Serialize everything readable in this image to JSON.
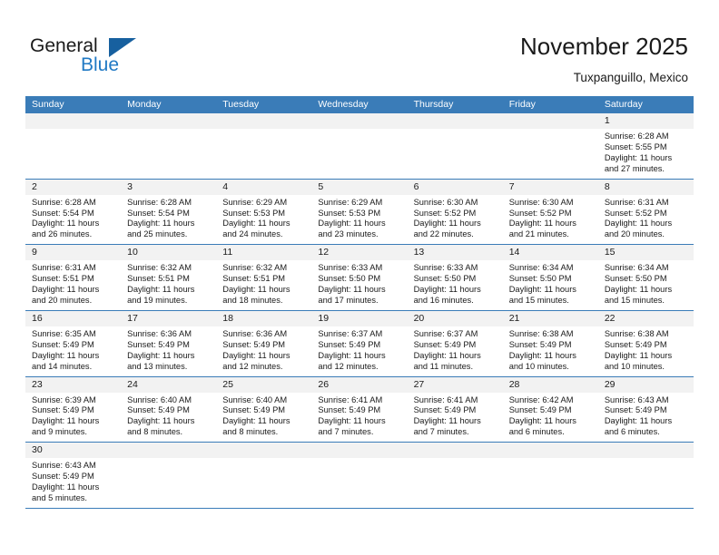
{
  "brand": {
    "name_part1": "General",
    "name_part2": "Blue"
  },
  "header": {
    "title": "November 2025",
    "subtitle": "Tuxpanguillo, Mexico"
  },
  "colors": {
    "header_blue": "#3a7cb8",
    "logo_blue": "#2079c4",
    "datestrip_gray": "#f2f2f2"
  },
  "calendar": {
    "weekday_headers": [
      "Sunday",
      "Monday",
      "Tuesday",
      "Wednesday",
      "Thursday",
      "Friday",
      "Saturday"
    ],
    "weeks": [
      {
        "days": [
          {
            "num": "",
            "lines": [
              "",
              "",
              "",
              ""
            ],
            "empty": true
          },
          {
            "num": "",
            "lines": [
              "",
              "",
              "",
              ""
            ],
            "empty": true
          },
          {
            "num": "",
            "lines": [
              "",
              "",
              "",
              ""
            ],
            "empty": true
          },
          {
            "num": "",
            "lines": [
              "",
              "",
              "",
              ""
            ],
            "empty": true
          },
          {
            "num": "",
            "lines": [
              "",
              "",
              "",
              ""
            ],
            "empty": true
          },
          {
            "num": "",
            "lines": [
              "",
              "",
              "",
              ""
            ],
            "empty": true
          },
          {
            "num": "1",
            "lines": [
              "Sunrise: 6:28 AM",
              "Sunset: 5:55 PM",
              "Daylight: 11 hours",
              "and 27 minutes."
            ],
            "empty": false
          }
        ]
      },
      {
        "days": [
          {
            "num": "2",
            "lines": [
              "Sunrise: 6:28 AM",
              "Sunset: 5:54 PM",
              "Daylight: 11 hours",
              "and 26 minutes."
            ],
            "empty": false
          },
          {
            "num": "3",
            "lines": [
              "Sunrise: 6:28 AM",
              "Sunset: 5:54 PM",
              "Daylight: 11 hours",
              "and 25 minutes."
            ],
            "empty": false
          },
          {
            "num": "4",
            "lines": [
              "Sunrise: 6:29 AM",
              "Sunset: 5:53 PM",
              "Daylight: 11 hours",
              "and 24 minutes."
            ],
            "empty": false
          },
          {
            "num": "5",
            "lines": [
              "Sunrise: 6:29 AM",
              "Sunset: 5:53 PM",
              "Daylight: 11 hours",
              "and 23 minutes."
            ],
            "empty": false
          },
          {
            "num": "6",
            "lines": [
              "Sunrise: 6:30 AM",
              "Sunset: 5:52 PM",
              "Daylight: 11 hours",
              "and 22 minutes."
            ],
            "empty": false
          },
          {
            "num": "7",
            "lines": [
              "Sunrise: 6:30 AM",
              "Sunset: 5:52 PM",
              "Daylight: 11 hours",
              "and 21 minutes."
            ],
            "empty": false
          },
          {
            "num": "8",
            "lines": [
              "Sunrise: 6:31 AM",
              "Sunset: 5:52 PM",
              "Daylight: 11 hours",
              "and 20 minutes."
            ],
            "empty": false
          }
        ]
      },
      {
        "days": [
          {
            "num": "9",
            "lines": [
              "Sunrise: 6:31 AM",
              "Sunset: 5:51 PM",
              "Daylight: 11 hours",
              "and 20 minutes."
            ],
            "empty": false
          },
          {
            "num": "10",
            "lines": [
              "Sunrise: 6:32 AM",
              "Sunset: 5:51 PM",
              "Daylight: 11 hours",
              "and 19 minutes."
            ],
            "empty": false
          },
          {
            "num": "11",
            "lines": [
              "Sunrise: 6:32 AM",
              "Sunset: 5:51 PM",
              "Daylight: 11 hours",
              "and 18 minutes."
            ],
            "empty": false
          },
          {
            "num": "12",
            "lines": [
              "Sunrise: 6:33 AM",
              "Sunset: 5:50 PM",
              "Daylight: 11 hours",
              "and 17 minutes."
            ],
            "empty": false
          },
          {
            "num": "13",
            "lines": [
              "Sunrise: 6:33 AM",
              "Sunset: 5:50 PM",
              "Daylight: 11 hours",
              "and 16 minutes."
            ],
            "empty": false
          },
          {
            "num": "14",
            "lines": [
              "Sunrise: 6:34 AM",
              "Sunset: 5:50 PM",
              "Daylight: 11 hours",
              "and 15 minutes."
            ],
            "empty": false
          },
          {
            "num": "15",
            "lines": [
              "Sunrise: 6:34 AM",
              "Sunset: 5:50 PM",
              "Daylight: 11 hours",
              "and 15 minutes."
            ],
            "empty": false
          }
        ]
      },
      {
        "days": [
          {
            "num": "16",
            "lines": [
              "Sunrise: 6:35 AM",
              "Sunset: 5:49 PM",
              "Daylight: 11 hours",
              "and 14 minutes."
            ],
            "empty": false
          },
          {
            "num": "17",
            "lines": [
              "Sunrise: 6:36 AM",
              "Sunset: 5:49 PM",
              "Daylight: 11 hours",
              "and 13 minutes."
            ],
            "empty": false
          },
          {
            "num": "18",
            "lines": [
              "Sunrise: 6:36 AM",
              "Sunset: 5:49 PM",
              "Daylight: 11 hours",
              "and 12 minutes."
            ],
            "empty": false
          },
          {
            "num": "19",
            "lines": [
              "Sunrise: 6:37 AM",
              "Sunset: 5:49 PM",
              "Daylight: 11 hours",
              "and 12 minutes."
            ],
            "empty": false
          },
          {
            "num": "20",
            "lines": [
              "Sunrise: 6:37 AM",
              "Sunset: 5:49 PM",
              "Daylight: 11 hours",
              "and 11 minutes."
            ],
            "empty": false
          },
          {
            "num": "21",
            "lines": [
              "Sunrise: 6:38 AM",
              "Sunset: 5:49 PM",
              "Daylight: 11 hours",
              "and 10 minutes."
            ],
            "empty": false
          },
          {
            "num": "22",
            "lines": [
              "Sunrise: 6:38 AM",
              "Sunset: 5:49 PM",
              "Daylight: 11 hours",
              "and 10 minutes."
            ],
            "empty": false
          }
        ]
      },
      {
        "days": [
          {
            "num": "23",
            "lines": [
              "Sunrise: 6:39 AM",
              "Sunset: 5:49 PM",
              "Daylight: 11 hours",
              "and 9 minutes."
            ],
            "empty": false
          },
          {
            "num": "24",
            "lines": [
              "Sunrise: 6:40 AM",
              "Sunset: 5:49 PM",
              "Daylight: 11 hours",
              "and 8 minutes."
            ],
            "empty": false
          },
          {
            "num": "25",
            "lines": [
              "Sunrise: 6:40 AM",
              "Sunset: 5:49 PM",
              "Daylight: 11 hours",
              "and 8 minutes."
            ],
            "empty": false
          },
          {
            "num": "26",
            "lines": [
              "Sunrise: 6:41 AM",
              "Sunset: 5:49 PM",
              "Daylight: 11 hours",
              "and 7 minutes."
            ],
            "empty": false
          },
          {
            "num": "27",
            "lines": [
              "Sunrise: 6:41 AM",
              "Sunset: 5:49 PM",
              "Daylight: 11 hours",
              "and 7 minutes."
            ],
            "empty": false
          },
          {
            "num": "28",
            "lines": [
              "Sunrise: 6:42 AM",
              "Sunset: 5:49 PM",
              "Daylight: 11 hours",
              "and 6 minutes."
            ],
            "empty": false
          },
          {
            "num": "29",
            "lines": [
              "Sunrise: 6:43 AM",
              "Sunset: 5:49 PM",
              "Daylight: 11 hours",
              "and 6 minutes."
            ],
            "empty": false
          }
        ]
      },
      {
        "days": [
          {
            "num": "30",
            "lines": [
              "Sunrise: 6:43 AM",
              "Sunset: 5:49 PM",
              "Daylight: 11 hours",
              "and 5 minutes."
            ],
            "empty": false
          },
          {
            "num": "",
            "lines": [
              "",
              "",
              "",
              ""
            ],
            "empty": true
          },
          {
            "num": "",
            "lines": [
              "",
              "",
              "",
              ""
            ],
            "empty": true
          },
          {
            "num": "",
            "lines": [
              "",
              "",
              "",
              ""
            ],
            "empty": true
          },
          {
            "num": "",
            "lines": [
              "",
              "",
              "",
              ""
            ],
            "empty": true
          },
          {
            "num": "",
            "lines": [
              "",
              "",
              "",
              ""
            ],
            "empty": true
          },
          {
            "num": "",
            "lines": [
              "",
              "",
              "",
              ""
            ],
            "empty": true
          }
        ]
      }
    ]
  }
}
